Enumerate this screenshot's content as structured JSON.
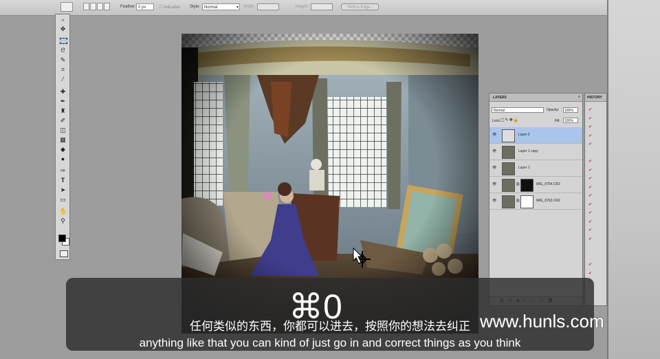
{
  "options_bar": {
    "feather_label": "Feather:",
    "feather_value": "0 px",
    "antialias_label": "Anti-alias",
    "style_label": "Style:",
    "style_value": "Normal",
    "width_label": "Width:",
    "height_label": "Height:",
    "refine_edge_label": "Refine Edge..."
  },
  "layers_panel": {
    "tab_layers": "LAYERS",
    "tab_history": "HISTORY",
    "blend_mode": "Normal",
    "opacity_label": "Opacity:",
    "opacity_value": "100%",
    "lock_label": "Lock:",
    "fill_label": "Fill:",
    "fill_value": "100%",
    "layers": [
      {
        "name": "Layer 2",
        "selected": true
      },
      {
        "name": "Layer 1 copy",
        "selected": false
      },
      {
        "name": "Layer 1",
        "selected": false
      },
      {
        "name": "IMG_9754.CR2",
        "selected": false
      },
      {
        "name": "IMG_9763.CR2",
        "selected": false
      }
    ]
  },
  "overlay": {
    "shortcut_text": "⌘0",
    "subtitle_zh": "任何类似的东西，你都可以进去，按照你的想法去纠正",
    "subtitle_en": "anything like that you can kind of just go in and correct things as you think",
    "watermark": "www.hunls.com"
  },
  "colors": {
    "selected_layer": "#a9c5ea",
    "subtitle_box": "#2d2d2d",
    "checkbox_red": "#c2272d"
  }
}
